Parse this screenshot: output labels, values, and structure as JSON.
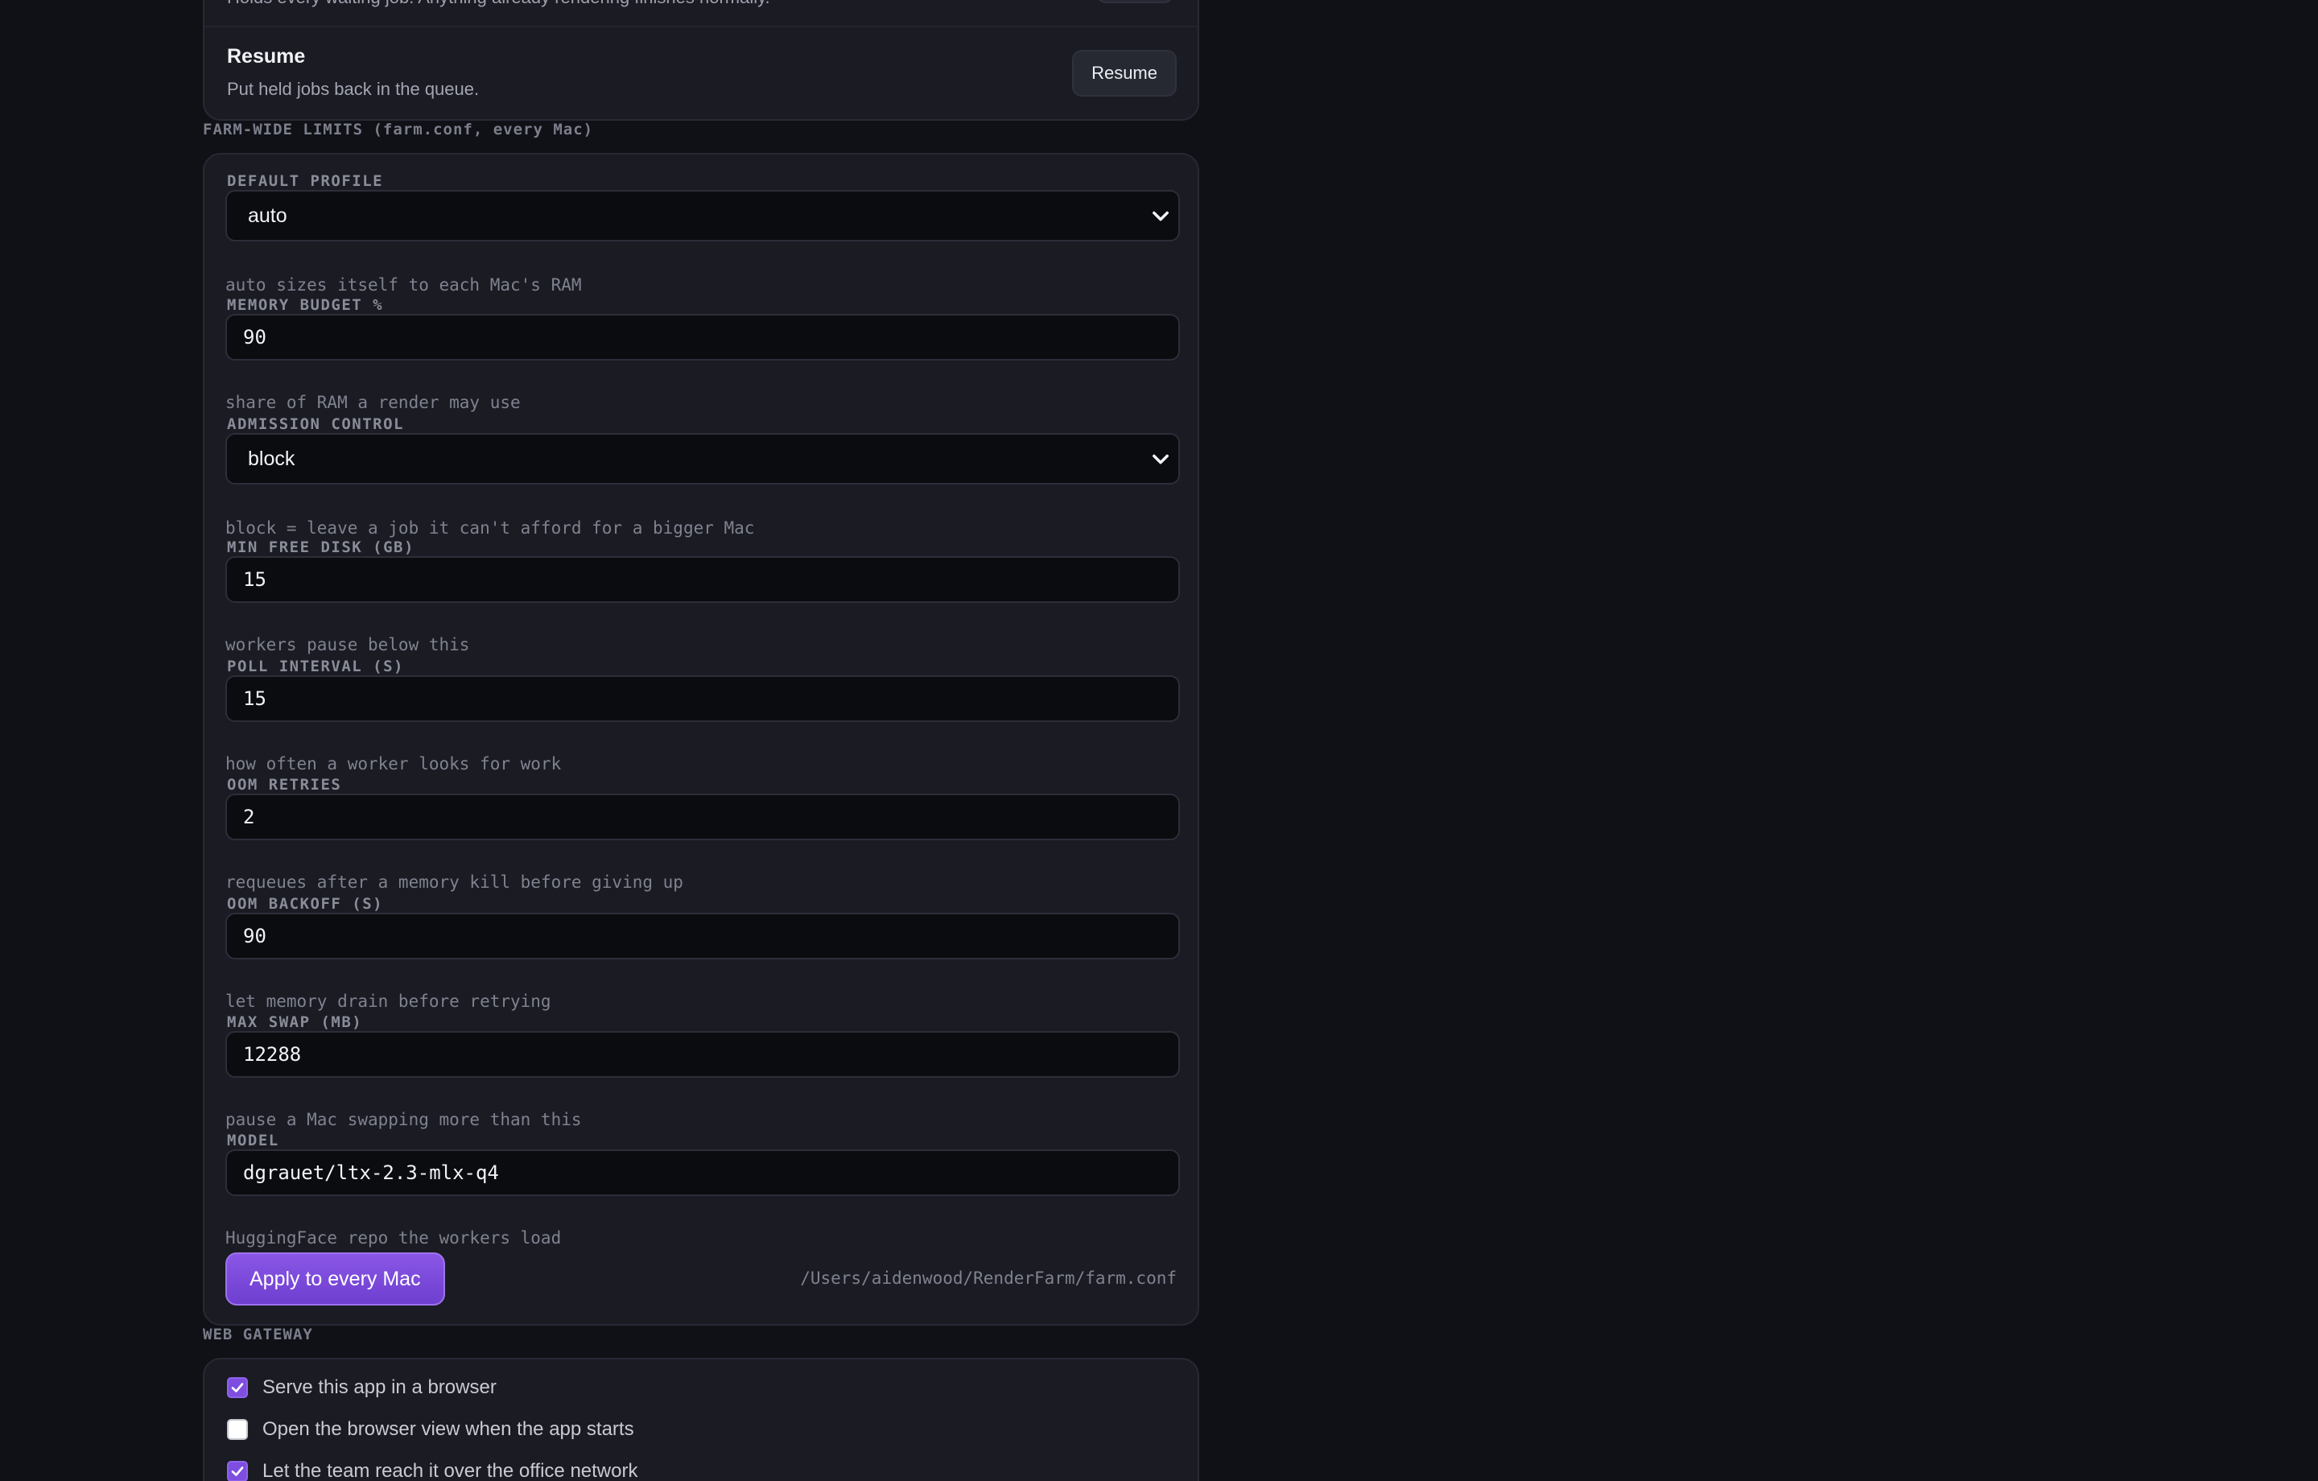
{
  "controls_card": {
    "partial_row": {
      "description": "Holds every waiting job. Anything already rendering finishes normally."
    },
    "resume_row": {
      "title": "Resume",
      "description": "Put held jobs back in the queue.",
      "button_label": "Resume"
    }
  },
  "limits": {
    "section_title": "FARM-WIDE LIMITS (farm.conf, every Mac)",
    "fields": [
      {
        "label": "DEFAULT PROFILE",
        "kind": "select",
        "value": "auto",
        "hint": "auto sizes itself to each Mac's RAM"
      },
      {
        "label": "MEMORY BUDGET %",
        "kind": "input",
        "value": "90",
        "hint": "share of RAM a render may use"
      },
      {
        "label": "ADMISSION CONTROL",
        "kind": "select",
        "value": "block",
        "hint": "block = leave a job it can't afford for a bigger Mac"
      },
      {
        "label": "MIN FREE DISK (GB)",
        "kind": "input",
        "value": "15",
        "hint": "workers pause below this"
      },
      {
        "label": "POLL INTERVAL (S)",
        "kind": "input",
        "value": "15",
        "hint": "how often a worker looks for work"
      },
      {
        "label": "OOM RETRIES",
        "kind": "input",
        "value": "2",
        "hint": "requeues after a memory kill before giving up"
      },
      {
        "label": "OOM BACKOFF (S)",
        "kind": "input",
        "value": "90",
        "hint": "let memory drain before retrying"
      },
      {
        "label": "MAX SWAP (MB)",
        "kind": "input",
        "value": "12288",
        "hint": "pause a Mac swapping more than this"
      },
      {
        "label": "MODEL",
        "kind": "input",
        "value": "dgrauet/ltx-2.3-mlx-q4",
        "hint": "HuggingFace repo the workers load"
      }
    ],
    "apply_button_label": "Apply to every Mac",
    "config_path": "/Users/aidenwood/RenderFarm/farm.conf"
  },
  "gateway": {
    "section_title": "WEB GATEWAY",
    "options": [
      {
        "label": "Serve this app in a browser",
        "checked": true
      },
      {
        "label": "Open the browser view when the app starts",
        "checked": false
      },
      {
        "label": "Let the team reach it over the office network",
        "checked": true
      }
    ]
  },
  "colors": {
    "background": "#101116",
    "card": "#1a1b23",
    "accent": "#7d4ee0",
    "muted_text": "#7f828f"
  }
}
